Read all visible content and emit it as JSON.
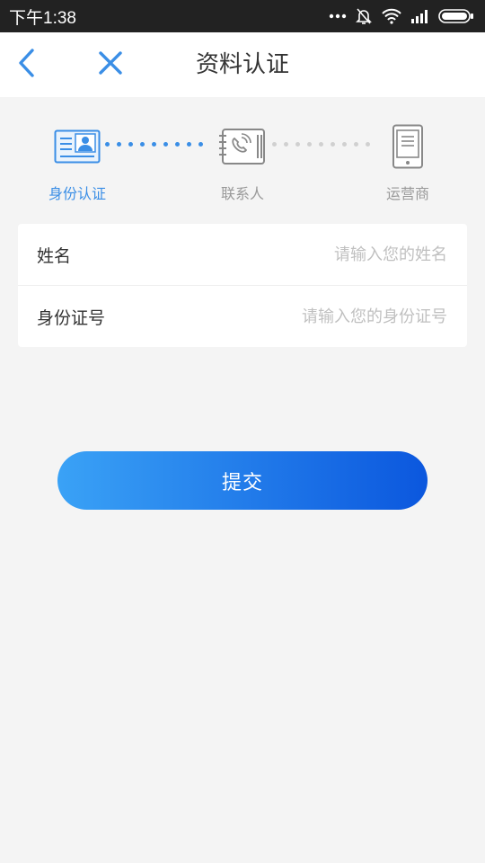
{
  "statusbar": {
    "time": "下午1:38",
    "icons": [
      "more-dots-icon",
      "bell-mute-icon",
      "wifi-icon",
      "signal-icon",
      "battery-icon"
    ]
  },
  "appbar": {
    "title": "资料认证",
    "back_icon": "chevron-left-icon",
    "close_icon": "close-icon"
  },
  "steps": [
    {
      "label": "身份认证",
      "icon": "id-card-icon",
      "active": true
    },
    {
      "label": "联系人",
      "icon": "contact-book-icon",
      "active": false
    },
    {
      "label": "运营商",
      "icon": "phone-icon",
      "active": false
    }
  ],
  "form": {
    "name": {
      "label": "姓名",
      "placeholder": "请输入您的姓名",
      "value": ""
    },
    "id_number": {
      "label": "身份证号",
      "placeholder": "请输入您的身份证号",
      "value": ""
    }
  },
  "submit_label": "提交",
  "colors": {
    "accent": "#3a8ee6",
    "inactive": "#999999",
    "button_start": "#3aa2f6",
    "button_end": "#0b57de"
  }
}
